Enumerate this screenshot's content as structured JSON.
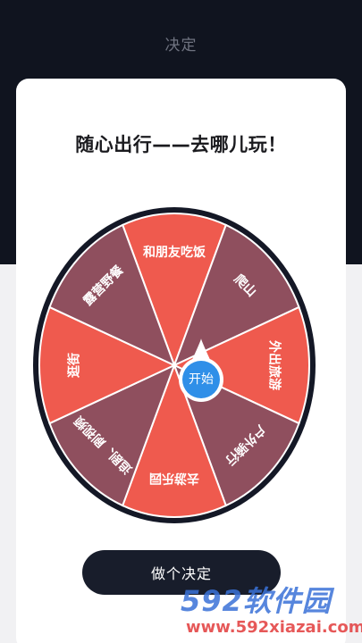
{
  "header": {
    "title": "决定"
  },
  "card": {
    "title": "随心出行——去哪儿玩！"
  },
  "wheel": {
    "start_label": "开始",
    "segments": [
      {
        "label": "和朋友吃饭",
        "color": "#ef5a4e"
      },
      {
        "label": "爬山",
        "color": "#8f4f5e"
      },
      {
        "label": "外出旅游",
        "color": "#ef5a4e"
      },
      {
        "label": "户外骑行",
        "color": "#8f4f5e"
      },
      {
        "label": "去游乐园",
        "color": "#ef5a4e"
      },
      {
        "label": "追剧、刷视频",
        "color": "#8f4f5e"
      },
      {
        "label": "逛街",
        "color": "#ef5a4e"
      },
      {
        "label": "露营野餐",
        "color": "#8f4f5e"
      }
    ],
    "rim_color": "#141826",
    "center_color": "#2f8fe8"
  },
  "action": {
    "decide_label": "做个决定"
  },
  "watermark": {
    "brand": "592软件园",
    "url": "www.592xiazai.com"
  }
}
